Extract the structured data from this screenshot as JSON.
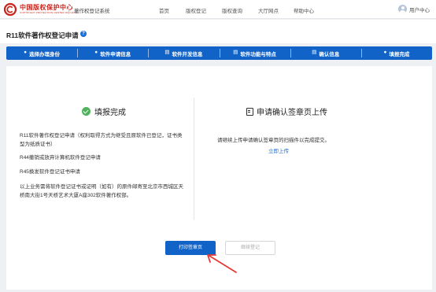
{
  "header": {
    "brand_cn": "中国版权保护中心",
    "brand_en": "COPYRIGHT PROTECTION CENTER OF CHINA",
    "system_name": "著作权登记系统",
    "nav": [
      "首页",
      "版权登记",
      "版权查询",
      "大厅网点",
      "帮助中心"
    ],
    "user_label": "用户中心"
  },
  "page": {
    "title": "R11软件著作权登记申请",
    "help_icon": "?"
  },
  "steps": [
    {
      "icon": "user-icon",
      "glyph": "●",
      "label": "选择办理身份"
    },
    {
      "icon": "location-icon",
      "glyph": "●",
      "label": "软件申请信息"
    },
    {
      "icon": "document-icon",
      "glyph": "▤",
      "label": "软件开发信息"
    },
    {
      "icon": "document-icon",
      "glyph": "▤",
      "label": "软件功能与特点"
    },
    {
      "icon": "document-icon",
      "glyph": "▤",
      "label": "确认信息"
    },
    {
      "icon": "check-circle-icon",
      "glyph": "●",
      "label": "填报完成"
    }
  ],
  "left_panel": {
    "title": "填报完成",
    "paragraphs": [
      "R11软件著作权登记申请（权利取得方式为继受且原软件已登记，证书类型为纸质证书）",
      "R44撤销或放弃计算机软件登记申请",
      "R45换发软件登记证书申请",
      "以上业务需将软件登记证书或证明（如有）的原件邮寄至北京市西城区天桥南大街1号天桥艺术大厦A座302软件著作权部。"
    ]
  },
  "right_panel": {
    "title": "申请确认签章页上传",
    "description": "请继续上传申请确认签章页的扫描件以完成提交。",
    "link": "立即上传"
  },
  "actions": {
    "print_label": "打印签章页",
    "continue_label": "继续登记"
  },
  "colors": {
    "primary": "#1263c8",
    "brand_red": "#c8241c",
    "success": "#4fb35a",
    "annotation_arrow": "#e53935"
  }
}
